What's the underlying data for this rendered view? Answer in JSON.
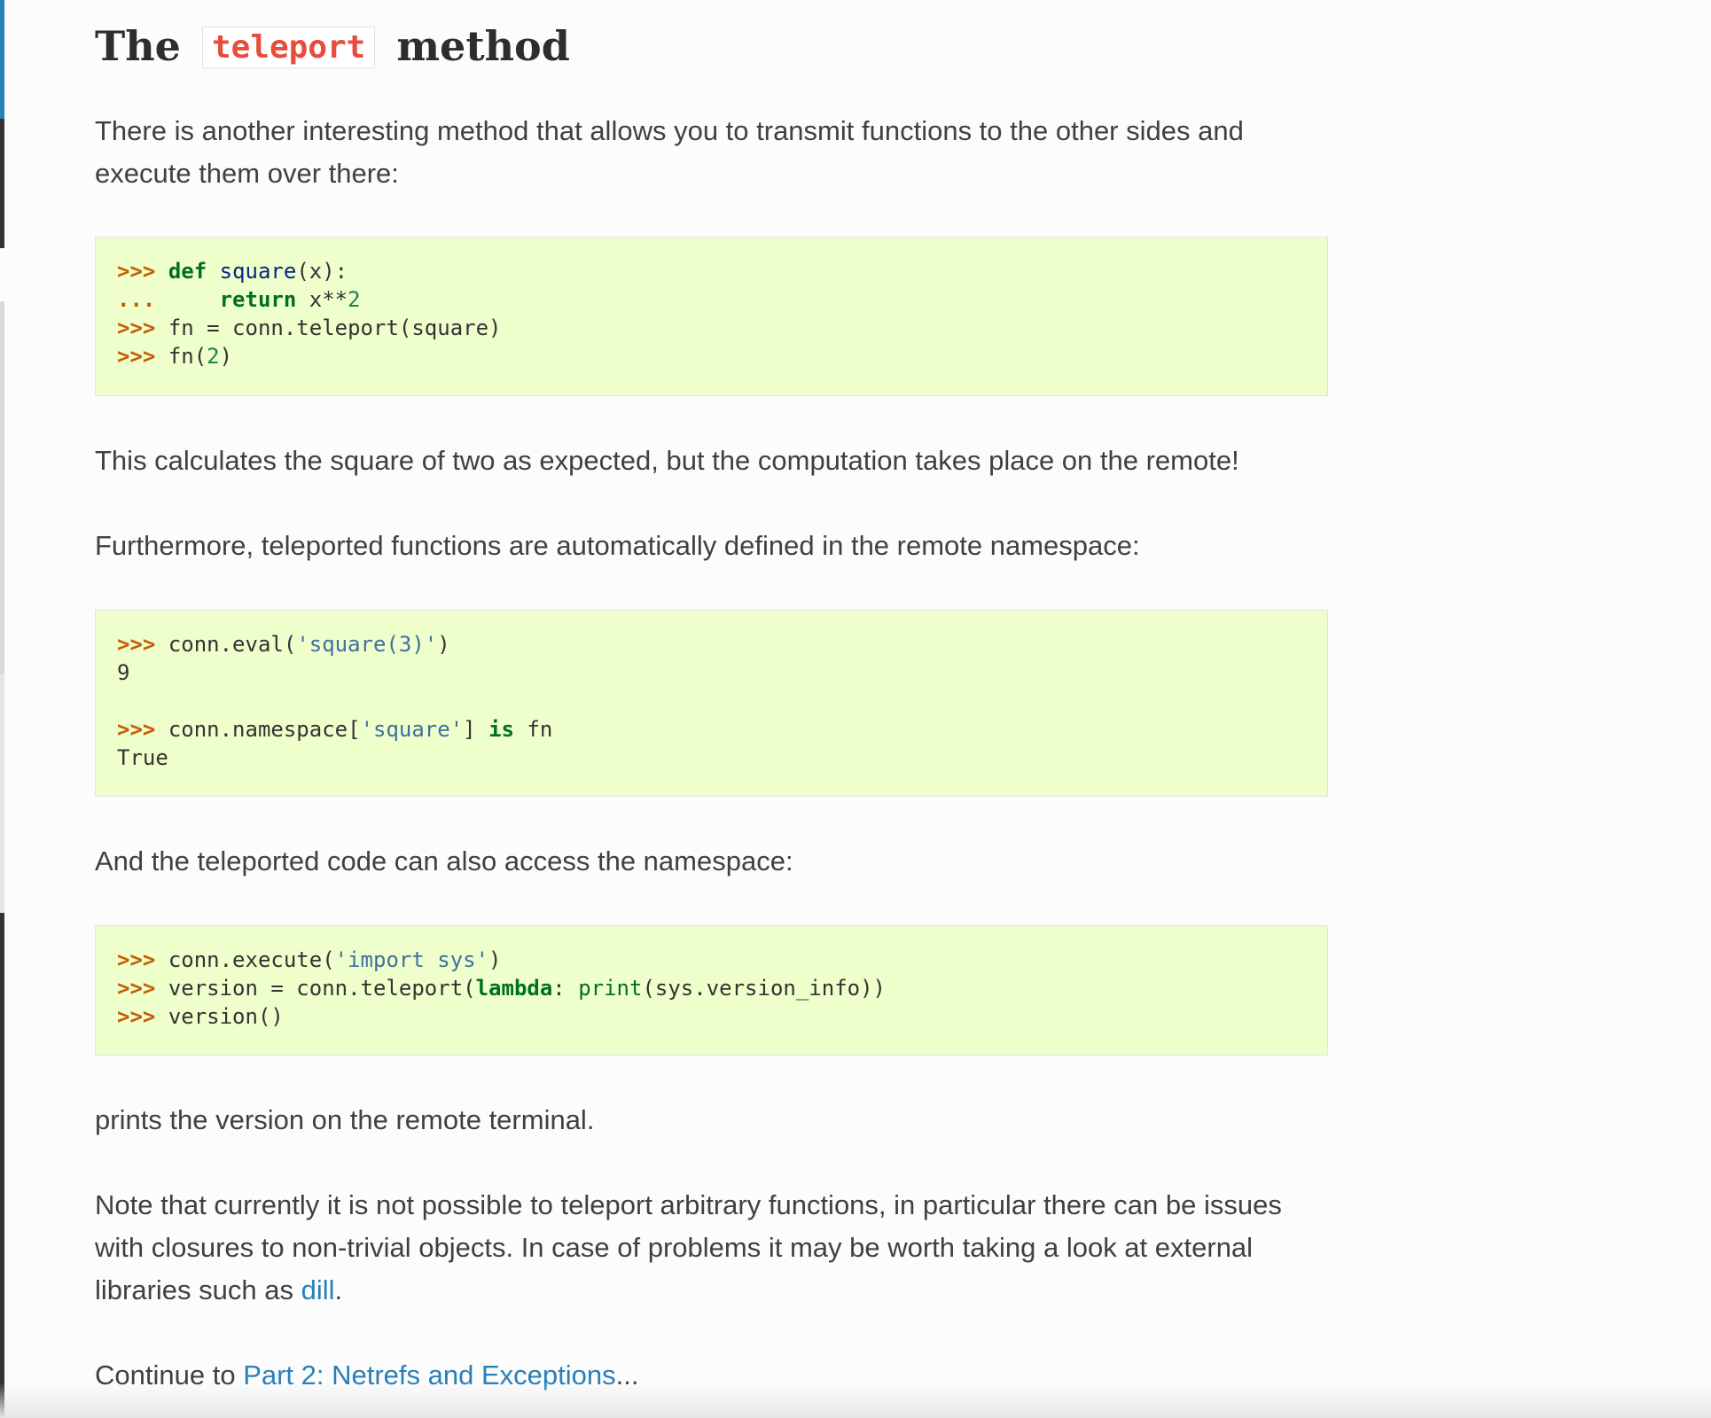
{
  "heading": {
    "prefix": "The",
    "code": "teleport",
    "suffix": "method"
  },
  "intro": "There is another interesting method that allows you to transmit functions to the other sides and execute them over there:",
  "code1": {
    "prompt": ">>>",
    "cont": "...",
    "l1_kw": "def",
    "l1_fn": "square",
    "l1_rest": "(x):",
    "l2_kw": "return",
    "l2_mid": "x",
    "l2_op": "**",
    "l2_num": "2",
    "l3": "fn = conn.teleport(square)",
    "l4_a": "fn(",
    "l4_num": "2",
    "l4_b": ")"
  },
  "para2": "This calculates the square of two as expected, but the computation takes place on the remote!",
  "para3": "Furthermore, teleported functions are automatically defined in the remote namespace:",
  "code2": {
    "prompt": ">>>",
    "l1_a": "conn.eval(",
    "l1_s": "'square(3)'",
    "l1_b": ")",
    "l2": "9",
    "l3_a": "conn.namespace[",
    "l3_s": "'square'",
    "l3_b": "]",
    "l3_is": "is",
    "l3_c": "fn",
    "l4": "True"
  },
  "para4": "And the teleported code can also access the namespace:",
  "code3": {
    "prompt": ">>>",
    "l1_a": "conn.execute(",
    "l1_s": "'import sys'",
    "l1_b": ")",
    "l2_a": "version = conn.teleport(",
    "l2_kw": "lambda",
    "l2_colon": ":",
    "l2_nb": "print",
    "l2_b": "(sys.version_info))",
    "l3": "version()"
  },
  "para5": "prints the version on the remote terminal.",
  "para6": {
    "text": "Note that currently it is not possible to teleport arbitrary functions, in particular there can be issues with closures to non-trivial objects. In case of problems it may be worth taking a look at external libraries such as",
    "link": "dill",
    "end": "."
  },
  "para7": {
    "prefix": "Continue to",
    "link": "Part 2: Netrefs and Exceptions",
    "suffix": "..."
  }
}
